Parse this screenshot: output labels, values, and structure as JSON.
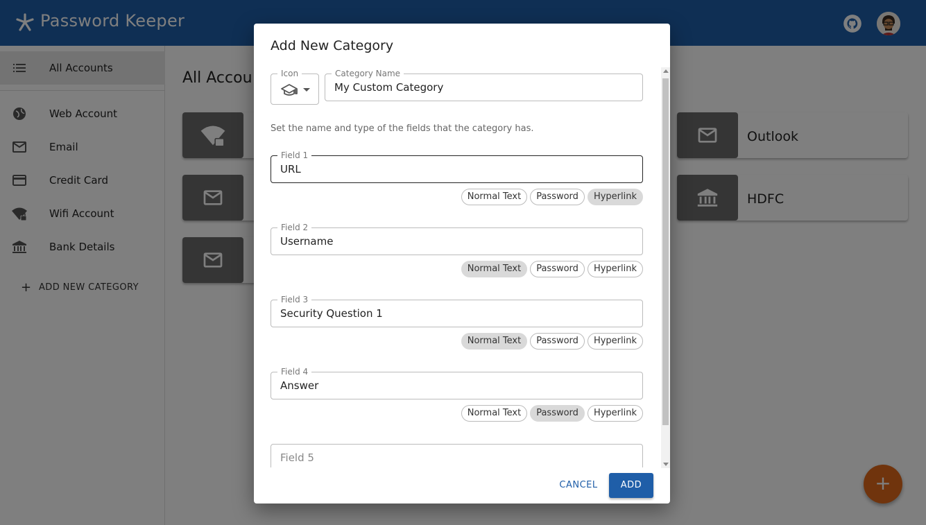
{
  "app": {
    "title": "Password Keeper"
  },
  "sidebar": {
    "items": [
      {
        "label": "All Accounts",
        "icon": "list-icon"
      },
      {
        "label": "Web Account",
        "icon": "globe-icon"
      },
      {
        "label": "Email",
        "icon": "mail-icon"
      },
      {
        "label": "Credit Card",
        "icon": "credit-card-icon"
      },
      {
        "label": "Wifi Account",
        "icon": "wifi-lock-icon"
      },
      {
        "label": "Bank Details",
        "icon": "bank-icon"
      }
    ],
    "add_category": "ADD NEW CATEGORY"
  },
  "main": {
    "title": "All Accou",
    "cards": [
      {
        "label": "Outlook",
        "icon": "mail-icon"
      },
      {
        "label": "HDFC",
        "icon": "bank-icon"
      }
    ]
  },
  "dialog": {
    "title": "Add New Category",
    "icon_label": "Icon",
    "icon_value": "graduation-cap-icon",
    "category_name_label": "Category Name",
    "category_name_value": "My Custom Category",
    "hint": "Set the name and type of the fields that the category has.",
    "field_types": [
      "Normal Text",
      "Password",
      "Hyperlink"
    ],
    "fields": [
      {
        "label": "Field 1",
        "value": "URL",
        "selected_type": "Hyperlink"
      },
      {
        "label": "Field 2",
        "value": "Username",
        "selected_type": "Normal Text"
      },
      {
        "label": "Field 3",
        "value": "Security Question 1",
        "selected_type": "Normal Text"
      },
      {
        "label": "Field 4",
        "value": "Answer",
        "selected_type": "Password"
      }
    ],
    "next_field_placeholder": "Field 5",
    "cancel_label": "CANCEL",
    "add_label": "ADD"
  },
  "colors": {
    "primary": "#1f5ea8",
    "accent": "#e0691a",
    "card_icon_bg": "#6b6b6b"
  }
}
